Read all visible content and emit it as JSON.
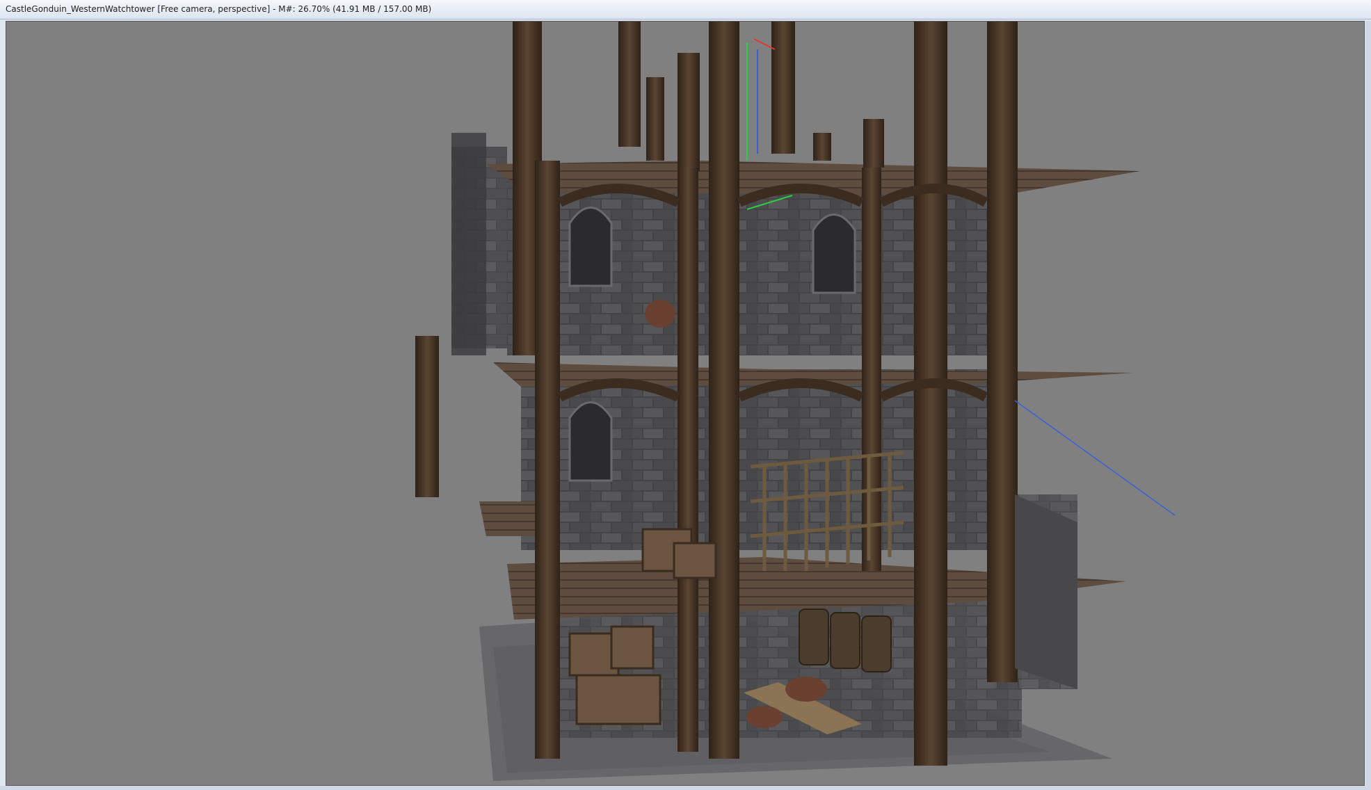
{
  "window": {
    "title": "CastleGonduin_WesternWatchtower [Free camera, perspective] - M#: 26.70% (41.91 MB / 157.00 MB)"
  },
  "viewport": {
    "camera_mode": "Free camera, perspective",
    "background_color": "#808080"
  },
  "colors": {
    "wood_dark": "#3b2c1f",
    "wood_mid": "#5a4330",
    "wood_light": "#7a6250",
    "stone_dark": "#3d3d3f",
    "stone_mid": "#555558",
    "floor_stone": "#6a6a68",
    "gizmo_green": "#2ecc40",
    "gizmo_red": "#e03a2f",
    "gizmo_blue": "#3a5fd8"
  },
  "icons": {
    "gizmo": "transform-gizmo-icon"
  }
}
